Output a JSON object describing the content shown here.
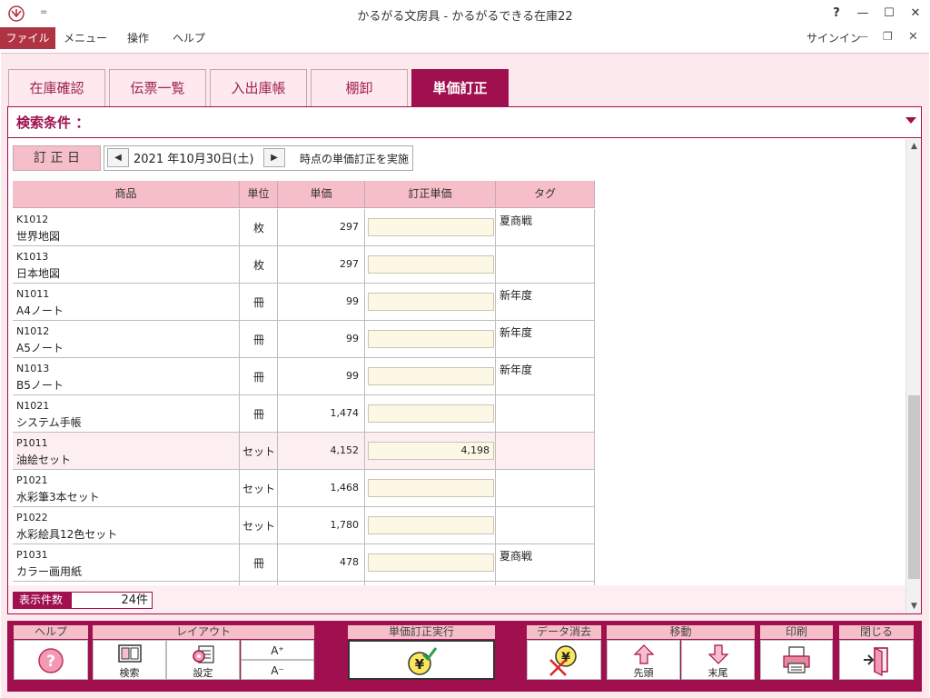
{
  "window": {
    "title": "かるがる文房具 - かるがるできる在庫22",
    "help_glyph": "?",
    "minimize_glyph": "—",
    "maximize_glyph": "☐",
    "close_glyph": "✕",
    "qat_glyph": "="
  },
  "menubar": {
    "items": [
      "ファイル",
      "メニュー",
      "操作",
      "ヘルプ"
    ],
    "signin": "サインイン"
  },
  "tabs": [
    {
      "label": "在庫確認",
      "active": false
    },
    {
      "label": "伝票一覧",
      "active": false
    },
    {
      "label": "入出庫帳",
      "active": false
    },
    {
      "label": "棚卸",
      "active": false
    },
    {
      "label": "単価訂正",
      "active": true
    }
  ],
  "search": {
    "label": "検索条件 ："
  },
  "date_row": {
    "label": "訂 正 日",
    "value": "2021 年10月30日(土)",
    "prev": "◀",
    "next": "▶",
    "suffix": "時点の単価訂正を実施"
  },
  "table": {
    "headers": [
      "商品",
      "単位",
      "単価",
      "訂正単価",
      "タグ"
    ],
    "rows": [
      {
        "code": "K1012",
        "name": "世界地図",
        "unit": "枚",
        "price": "297",
        "new_price": "",
        "tag": "夏商戦"
      },
      {
        "code": "K1013",
        "name": "日本地図",
        "unit": "枚",
        "price": "297",
        "new_price": "",
        "tag": ""
      },
      {
        "code": "N1011",
        "name": "A4ノート",
        "unit": "冊",
        "price": "99",
        "new_price": "",
        "tag": "新年度"
      },
      {
        "code": "N1012",
        "name": "A5ノート",
        "unit": "冊",
        "price": "99",
        "new_price": "",
        "tag": "新年度"
      },
      {
        "code": "N1013",
        "name": "B5ノート",
        "unit": "冊",
        "price": "99",
        "new_price": "",
        "tag": "新年度"
      },
      {
        "code": "N1021",
        "name": "システム手帳",
        "unit": "冊",
        "price": "1,474",
        "new_price": "",
        "tag": ""
      },
      {
        "code": "P1011",
        "name": "油絵セット",
        "unit": "セット",
        "price": "4,152",
        "new_price": "4,198",
        "tag": ""
      },
      {
        "code": "P1021",
        "name": "水彩筆3本セット",
        "unit": "セット",
        "price": "1,468",
        "new_price": "",
        "tag": ""
      },
      {
        "code": "P1022",
        "name": "水彩絵具12色セット",
        "unit": "セット",
        "price": "1,780",
        "new_price": "",
        "tag": ""
      },
      {
        "code": "P1031",
        "name": "カラー画用紙",
        "unit": "冊",
        "price": "478",
        "new_price": "",
        "tag": "夏商戦"
      }
    ]
  },
  "count": {
    "label": "表示件数",
    "value": "24件"
  },
  "toolbar": {
    "groups": {
      "help": "ヘルプ",
      "layout": "レイアウト",
      "execute": "単価訂正実行",
      "clear": "データ消去",
      "move": "移動",
      "print": "印刷",
      "close": "閉じる"
    },
    "buttons": {
      "search": "検索",
      "settings": "設定",
      "font_up": "A⁺",
      "font_down": "A⁻",
      "first": "先頭",
      "last": "末尾"
    }
  },
  "colors": {
    "accent": "#a0104e",
    "header_pink": "#f6bec8",
    "panel_bg": "#fbe9ee",
    "input_bg": "#fdf8e6"
  }
}
